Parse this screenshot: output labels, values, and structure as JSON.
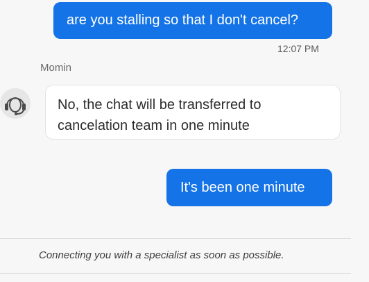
{
  "chat": {
    "messages": [
      {
        "sender": "user",
        "text": "are you stalling so that I don't cancel?",
        "timestamp": "12:07 PM"
      },
      {
        "sender": "agent",
        "name": "Momin",
        "avatar_icon": "headset-icon",
        "text": "No, the chat will be transferred to cancelation team in one minute"
      },
      {
        "sender": "user",
        "text": "It's been one minute"
      }
    ]
  },
  "status": {
    "text": "Connecting you with a specialist as soon as possible."
  },
  "colors": {
    "user_bubble": "#1473e6",
    "agent_bubble": "#ffffff",
    "background": "#f7f7f7"
  }
}
